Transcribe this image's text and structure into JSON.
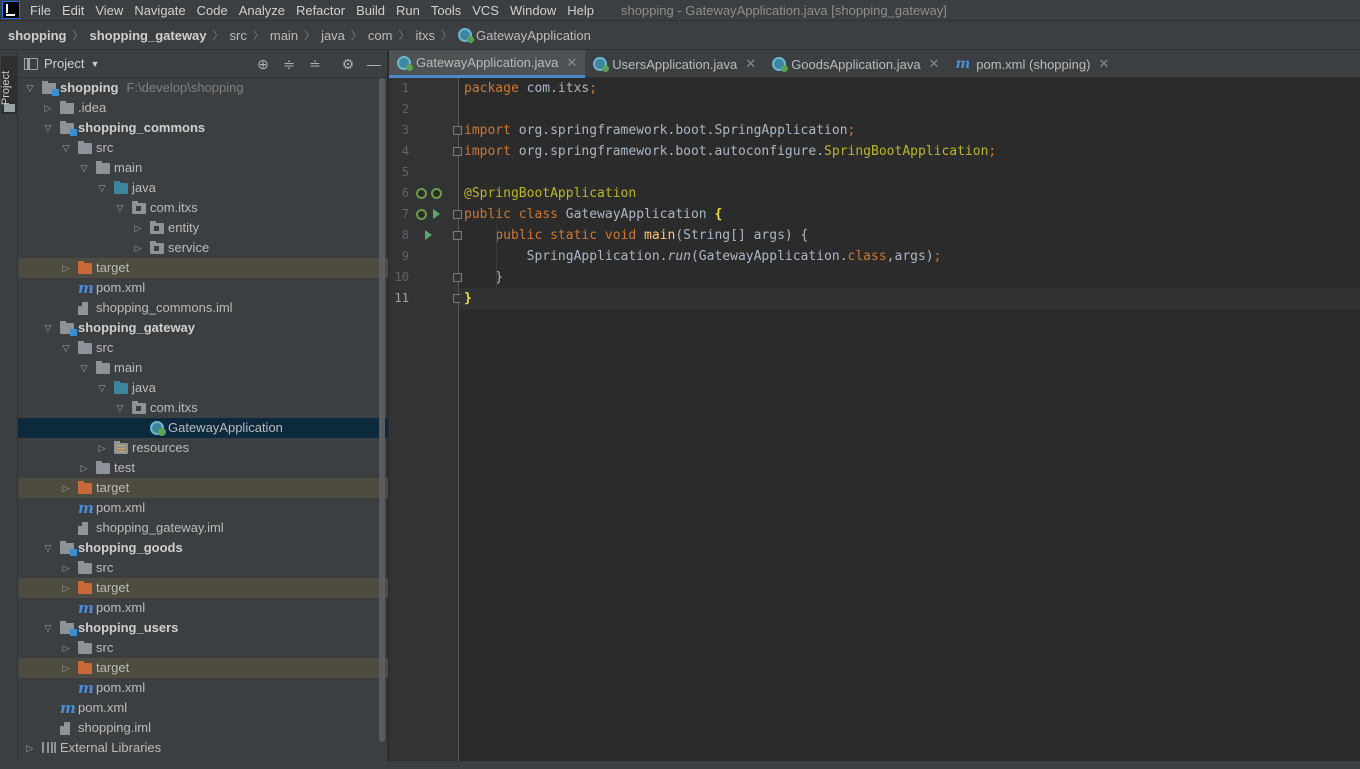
{
  "menubar": {
    "items": [
      "File",
      "Edit",
      "View",
      "Navigate",
      "Code",
      "Analyze",
      "Refactor",
      "Build",
      "Run",
      "Tools",
      "VCS",
      "Window",
      "Help"
    ],
    "window_title": "shopping - GatewayApplication.java [shopping_gateway]"
  },
  "breadcrumbs": [
    "shopping",
    "shopping_gateway",
    "src",
    "main",
    "java",
    "com",
    "itxs",
    "GatewayApplication"
  ],
  "tool_strip": {
    "project_label": "Project"
  },
  "project_panel": {
    "title": "Project",
    "icons": [
      "locate-icon",
      "expand-all-icon",
      "collapse-all-icon",
      "gear-icon",
      "minimize-icon"
    ]
  },
  "tree": [
    {
      "label": "shopping",
      "sub": "F:\\develop\\shopping",
      "depth": 0,
      "arrow": "down",
      "icon": "module-folder",
      "bold": true
    },
    {
      "label": ".idea",
      "depth": 1,
      "arrow": "right",
      "icon": "folder"
    },
    {
      "label": "shopping_commons",
      "depth": 1,
      "arrow": "down",
      "icon": "module-folder",
      "bold": true
    },
    {
      "label": "src",
      "depth": 2,
      "arrow": "down",
      "icon": "folder"
    },
    {
      "label": "main",
      "depth": 3,
      "arrow": "down",
      "icon": "folder"
    },
    {
      "label": "java",
      "depth": 4,
      "arrow": "down",
      "icon": "blue-folder"
    },
    {
      "label": "com.itxs",
      "depth": 5,
      "arrow": "down",
      "icon": "package-folder"
    },
    {
      "label": "entity",
      "depth": 6,
      "arrow": "right",
      "icon": "package-folder"
    },
    {
      "label": "service",
      "depth": 6,
      "arrow": "right",
      "icon": "package-folder"
    },
    {
      "label": "target",
      "depth": 2,
      "arrow": "right",
      "icon": "orange-folder",
      "excluded": true
    },
    {
      "label": "pom.xml",
      "depth": 2,
      "arrow": "none",
      "icon": "maven"
    },
    {
      "label": "shopping_commons.iml",
      "depth": 2,
      "arrow": "none",
      "icon": "iml"
    },
    {
      "label": "shopping_gateway",
      "depth": 1,
      "arrow": "down",
      "icon": "module-folder",
      "bold": true
    },
    {
      "label": "src",
      "depth": 2,
      "arrow": "down",
      "icon": "folder"
    },
    {
      "label": "main",
      "depth": 3,
      "arrow": "down",
      "icon": "folder"
    },
    {
      "label": "java",
      "depth": 4,
      "arrow": "down",
      "icon": "blue-folder"
    },
    {
      "label": "com.itxs",
      "depth": 5,
      "arrow": "down",
      "icon": "package-folder"
    },
    {
      "label": "GatewayApplication",
      "depth": 6,
      "arrow": "none",
      "icon": "spring-app",
      "selected": true
    },
    {
      "label": "resources",
      "depth": 4,
      "arrow": "right",
      "icon": "resources-folder"
    },
    {
      "label": "test",
      "depth": 3,
      "arrow": "right",
      "icon": "folder"
    },
    {
      "label": "target",
      "depth": 2,
      "arrow": "right",
      "icon": "orange-folder",
      "excluded": true
    },
    {
      "label": "pom.xml",
      "depth": 2,
      "arrow": "none",
      "icon": "maven"
    },
    {
      "label": "shopping_gateway.iml",
      "depth": 2,
      "arrow": "none",
      "icon": "iml"
    },
    {
      "label": "shopping_goods",
      "depth": 1,
      "arrow": "down",
      "icon": "module-folder",
      "bold": true
    },
    {
      "label": "src",
      "depth": 2,
      "arrow": "right",
      "icon": "folder"
    },
    {
      "label": "target",
      "depth": 2,
      "arrow": "right",
      "icon": "orange-folder",
      "excluded": true
    },
    {
      "label": "pom.xml",
      "depth": 2,
      "arrow": "none",
      "icon": "maven"
    },
    {
      "label": "shopping_users",
      "depth": 1,
      "arrow": "down",
      "icon": "module-folder",
      "bold": true
    },
    {
      "label": "src",
      "depth": 2,
      "arrow": "right",
      "icon": "folder"
    },
    {
      "label": "target",
      "depth": 2,
      "arrow": "right",
      "icon": "orange-folder",
      "excluded": true
    },
    {
      "label": "pom.xml",
      "depth": 2,
      "arrow": "none",
      "icon": "maven"
    },
    {
      "label": "pom.xml",
      "depth": 1,
      "arrow": "none",
      "icon": "maven"
    },
    {
      "label": "shopping.iml",
      "depth": 1,
      "arrow": "none",
      "icon": "iml"
    },
    {
      "label": "External Libraries",
      "depth": 0,
      "arrow": "right",
      "icon": "libraries"
    }
  ],
  "tabs": [
    {
      "label": "GatewayApplication.java",
      "icon": "spring-app",
      "active": true
    },
    {
      "label": "UsersApplication.java",
      "icon": "spring-app",
      "active": false
    },
    {
      "label": "GoodsApplication.java",
      "icon": "spring-app",
      "active": false
    },
    {
      "label": "pom.xml (shopping)",
      "icon": "maven",
      "active": false
    }
  ],
  "editor": {
    "current_line": 11,
    "lines": [
      [
        {
          "t": "package ",
          "c": "kw"
        },
        {
          "t": "com.itxs",
          "c": ""
        },
        {
          "t": ";",
          "c": "kw"
        }
      ],
      [],
      [
        {
          "t": "import ",
          "c": "kw"
        },
        {
          "t": "org.springframework.boot.SpringApplication",
          "c": ""
        },
        {
          "t": ";",
          "c": "kw"
        }
      ],
      [
        {
          "t": "import ",
          "c": "kw"
        },
        {
          "t": "org.springframework.boot.autoconfigure.",
          "c": ""
        },
        {
          "t": "SpringBootApplication",
          "c": "ann"
        },
        {
          "t": ";",
          "c": "kw"
        }
      ],
      [],
      [
        {
          "t": "@SpringBootApplication",
          "c": "ann"
        }
      ],
      [
        {
          "t": "public class ",
          "c": "kw"
        },
        {
          "t": "GatewayApplication ",
          "c": ""
        },
        {
          "t": "{",
          "c": "brace"
        }
      ],
      [
        {
          "t": "    public static void ",
          "c": "kw"
        },
        {
          "t": "main",
          "c": "fn"
        },
        {
          "t": "(String[] args) {",
          "c": ""
        }
      ],
      [
        {
          "t": "        SpringApplication.",
          "c": ""
        },
        {
          "t": "run",
          "c": "it"
        },
        {
          "t": "(GatewayApplication.",
          "c": ""
        },
        {
          "t": "class",
          "c": "kw"
        },
        {
          "t": ",args)",
          "c": ""
        },
        {
          "t": ";",
          "c": "kw"
        }
      ],
      [
        {
          "t": "    }",
          "c": ""
        }
      ],
      [
        {
          "t": "}",
          "c": "brace"
        }
      ]
    ]
  }
}
